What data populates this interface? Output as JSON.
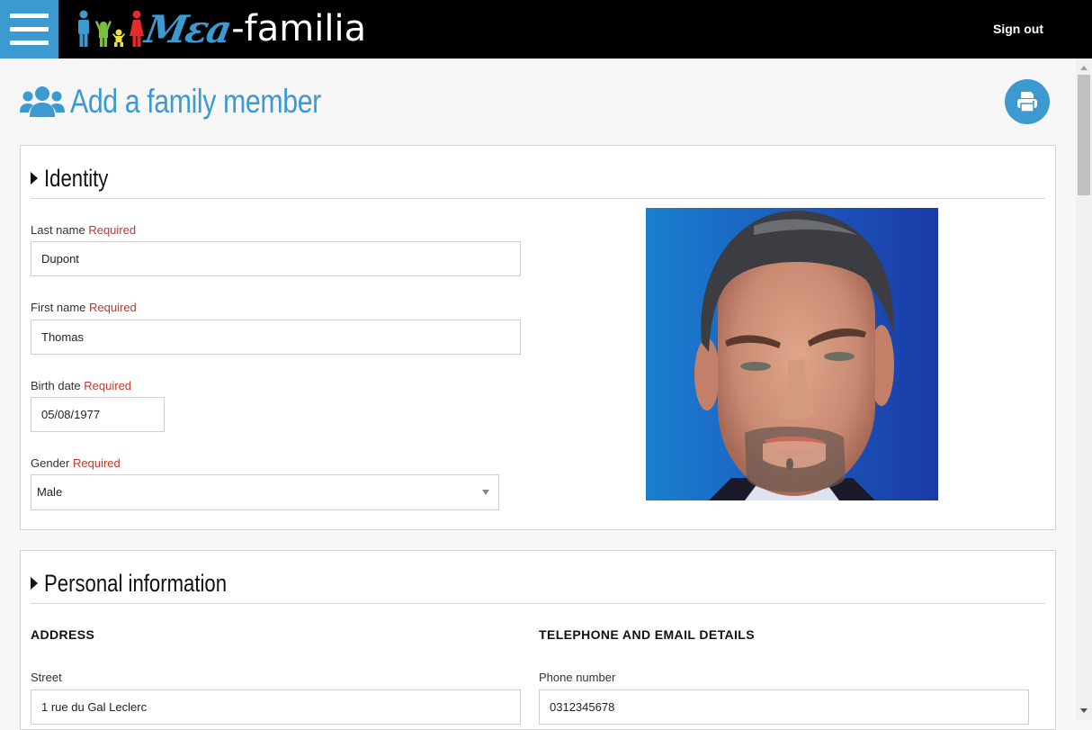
{
  "header": {
    "menu_icon": "hamburger-icon",
    "logo": {
      "mea": "Mεa",
      "familia": "-familia",
      "figure_colors": [
        "#3d9ad1",
        "#7dc142",
        "#e8e23a",
        "#e32b2b"
      ]
    },
    "sign_out_label": "Sign out"
  },
  "page": {
    "title": "Add a family member",
    "title_icon": "users-icon",
    "print_icon": "print-icon",
    "accent_color": "#3d9ad1"
  },
  "identity": {
    "title": "Identity",
    "required_text": "Required",
    "last_name": {
      "label": "Last name",
      "value": "Dupont"
    },
    "first_name": {
      "label": "First name",
      "value": "Thomas"
    },
    "birth_date": {
      "label": "Birth date",
      "value": "05/08/1977"
    },
    "gender": {
      "label": "Gender",
      "value": "Male"
    },
    "photo": "avatar-photo"
  },
  "personal": {
    "title": "Personal information",
    "address": {
      "heading": "ADDRESS",
      "street": {
        "label": "Street",
        "value": "1 rue du Gal Leclerc"
      }
    },
    "contact": {
      "heading": "TELEPHONE AND EMAIL DETAILS",
      "phone": {
        "label": "Phone number",
        "value": "0312345678"
      }
    }
  }
}
